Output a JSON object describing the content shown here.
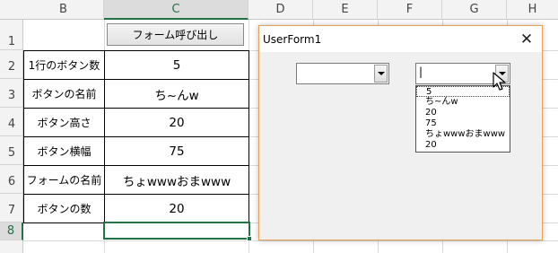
{
  "columns": [
    "B",
    "C",
    "D",
    "E",
    "F",
    "G",
    "H"
  ],
  "rows": [
    "1",
    "2",
    "3",
    "4",
    "5",
    "6",
    "7",
    "8"
  ],
  "sheet_button": {
    "label": "フォーム呼び出し"
  },
  "table": [
    {
      "label": "1行のボタン数",
      "value": "5"
    },
    {
      "label": "ボタンの名前",
      "value": "ち~んw"
    },
    {
      "label": "ボタン高さ",
      "value": "20"
    },
    {
      "label": "ボタン横幅",
      "value": "75"
    },
    {
      "label": "フォームの名前",
      "value": "ちょwwwおまwww"
    },
    {
      "label": "ボタンの数",
      "value": "20"
    }
  ],
  "userform": {
    "title": "UserForm1",
    "close_glyph": "✕",
    "combo1": {
      "value": ""
    },
    "combo2": {
      "value": "|"
    },
    "options": [
      "5",
      "ち~んw",
      "20",
      "75",
      "ちょwwwおまwww",
      "20"
    ]
  },
  "colors": {
    "accent": "#217346",
    "form_border": "#e8a15a"
  }
}
